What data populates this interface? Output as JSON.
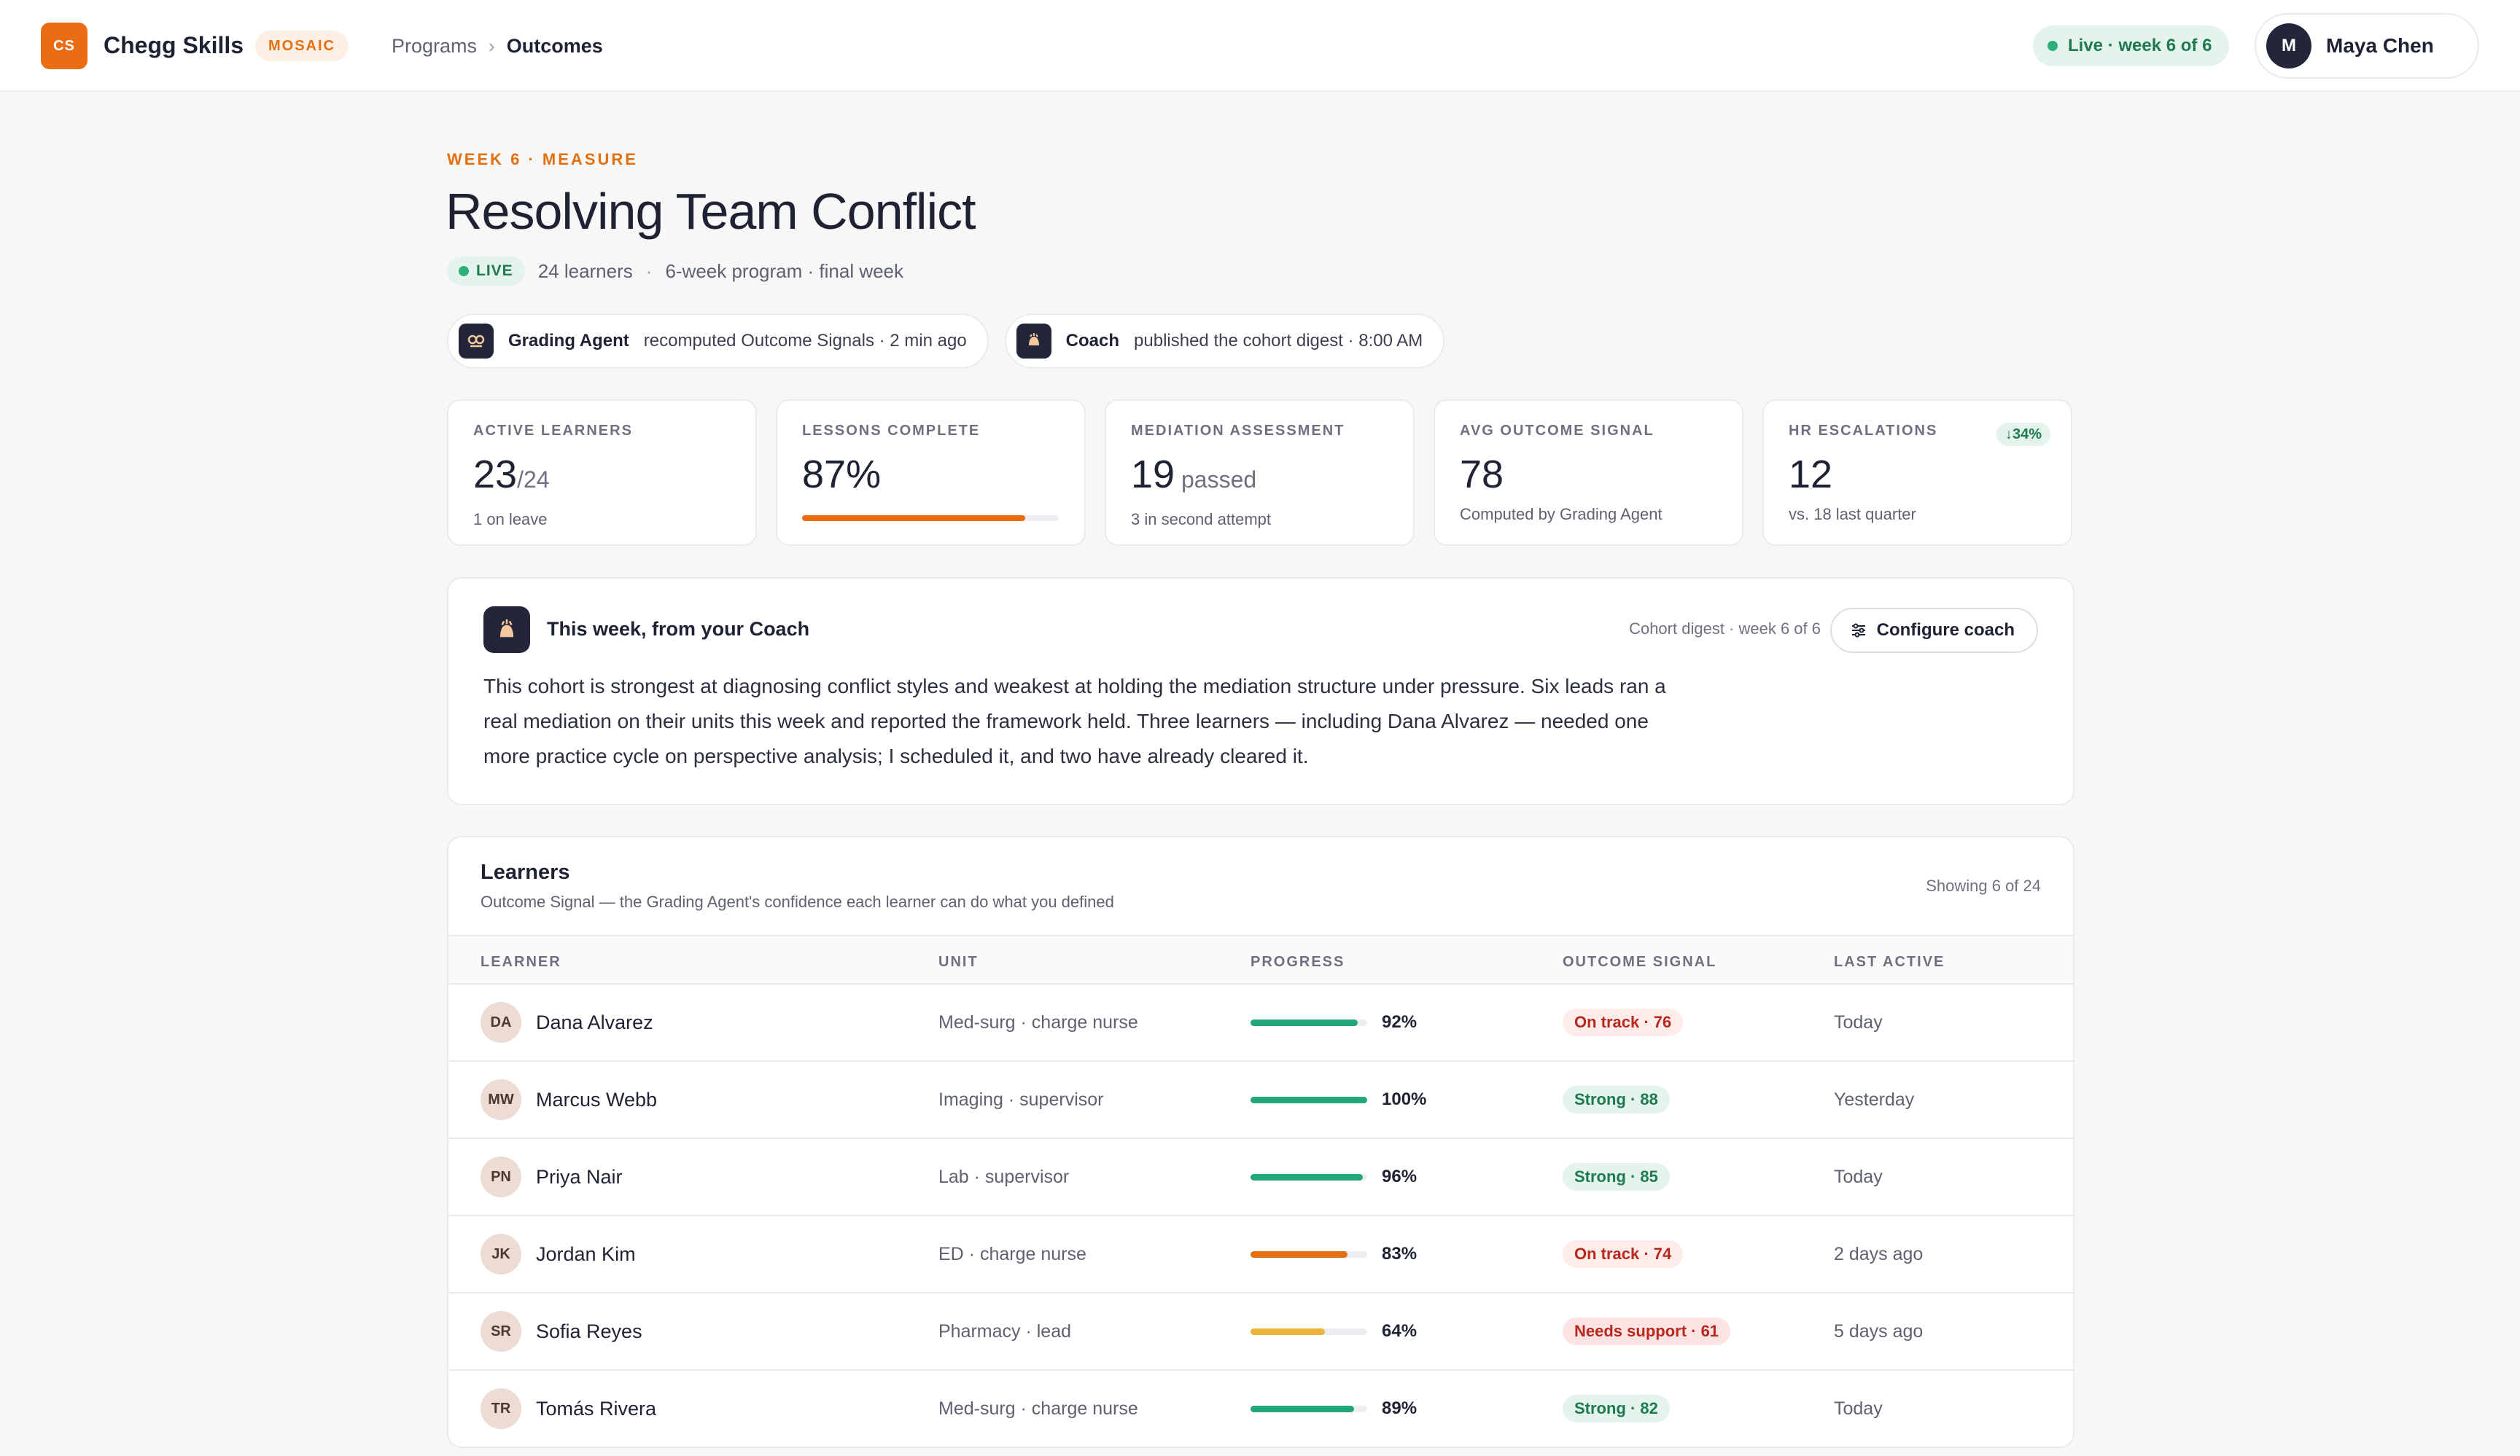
{
  "topbar": {
    "logo_text": "CS",
    "brand": "Chegg Skills",
    "badge": "MOSAIC",
    "breadcrumb": [
      "Programs",
      "Outcomes"
    ],
    "live_status": "Live · week 6 of 6",
    "user": {
      "initial": "M",
      "name": "Maya Chen"
    }
  },
  "header": {
    "eyebrow": "WEEK 6 · MEASURE",
    "title": "Resolving Team Conflict",
    "live_badge": "LIVE",
    "learners": "24 learners",
    "meta_sep": "·",
    "program": "6-week program · final week"
  },
  "agents": [
    {
      "icon": "grading-agent-icon",
      "name": "Grading Agent",
      "action": "recomputed Outcome Signals · 2 min ago"
    },
    {
      "icon": "coach-icon",
      "name": "Coach",
      "action": "published the cohort digest · 8:00 AM"
    }
  ],
  "stats": [
    {
      "label": "ACTIVE LEARNERS",
      "value": "23",
      "suffix": "/24",
      "sub": "1 on leave"
    },
    {
      "label": "LESSONS COMPLETE",
      "value": "87%",
      "progress": 0.87
    },
    {
      "label": "MEDIATION ASSESSMENT",
      "value": "19",
      "suffix": " passed",
      "sub": "3 in second attempt"
    },
    {
      "label": "AVG OUTCOME SIGNAL",
      "value": "78",
      "sub": "Computed by Grading Agent"
    },
    {
      "label": "HR ESCALATIONS",
      "value": "12",
      "sub": "vs. 18 last quarter",
      "delta": "↓34%"
    }
  ],
  "coach": {
    "title": "This week, from your Coach",
    "digest": "Cohort digest · week 6 of 6",
    "configure_label": "Configure coach",
    "body": "This cohort is strongest at diagnosing conflict styles and weakest at holding the mediation structure under pressure. Six leads ran a real mediation on their units this week and reported the framework held. Three learners — including Dana Alvarez — needed one more practice cycle on perspective analysis; I scheduled it, and two have already cleared it."
  },
  "learners": {
    "title": "Learners",
    "subtitle": "Outcome Signal — the Grading Agent's confidence each learner can do what you defined",
    "showing": "Showing 6 of 24",
    "columns": [
      "LEARNER",
      "UNIT",
      "PROGRESS",
      "OUTCOME SIGNAL",
      "LAST ACTIVE"
    ],
    "rows": [
      {
        "initials": "DA",
        "name": "Dana Alvarez",
        "unit": "Med-surg · charge nurse",
        "progress": 0.92,
        "progress_label": "92%",
        "bar_color": "#22a67a",
        "signal": "On track · 76",
        "signal_kind": "ontrack",
        "last_active": "Today"
      },
      {
        "initials": "MW",
        "name": "Marcus Webb",
        "unit": "Imaging · supervisor",
        "progress": 1.0,
        "progress_label": "100%",
        "bar_color": "#22a67a",
        "signal": "Strong · 88",
        "signal_kind": "strong",
        "last_active": "Yesterday"
      },
      {
        "initials": "PN",
        "name": "Priya Nair",
        "unit": "Lab · supervisor",
        "progress": 0.96,
        "progress_label": "96%",
        "bar_color": "#22a67a",
        "signal": "Strong · 85",
        "signal_kind": "strong",
        "last_active": "Today"
      },
      {
        "initials": "JK",
        "name": "Jordan Kim",
        "unit": "ED · charge nurse",
        "progress": 0.83,
        "progress_label": "83%",
        "bar_color": "#e3700f",
        "signal": "On track · 74",
        "signal_kind": "ontrack",
        "last_active": "2 days ago"
      },
      {
        "initials": "SR",
        "name": "Sofia Reyes",
        "unit": "Pharmacy · lead",
        "progress": 0.64,
        "progress_label": "64%",
        "bar_color": "#eab43a",
        "signal": "Needs support · 61",
        "signal_kind": "needs",
        "last_active": "5 days ago"
      },
      {
        "initials": "TR",
        "name": "Tomás Rivera",
        "unit": "Med-surg · charge nurse",
        "progress": 0.89,
        "progress_label": "89%",
        "bar_color": "#22a67a",
        "signal": "Strong · 82",
        "signal_kind": "strong",
        "last_active": "Today"
      }
    ]
  }
}
